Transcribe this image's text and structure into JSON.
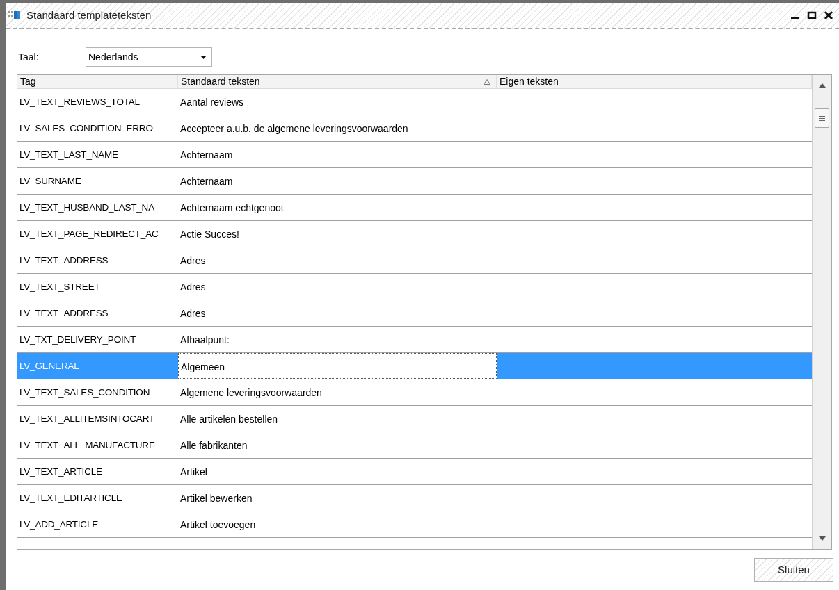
{
  "window": {
    "title": "Standaard templateteksten"
  },
  "language": {
    "label": "Taal:",
    "value": "Nederlands"
  },
  "table": {
    "columns": [
      {
        "label": "Tag",
        "sorted": false
      },
      {
        "label": "Standaard teksten",
        "sorted": true
      },
      {
        "label": "Eigen teksten",
        "sorted": false
      }
    ],
    "rows": [
      {
        "tag": "LV_TEXT_REVIEWS_TOTAL",
        "standard": "Aantal reviews",
        "selected": false
      },
      {
        "tag": "LV_SALES_CONDITION_ERRO",
        "standard": "Accepteer a.u.b. de algemene leveringsvoorwaarden",
        "selected": false
      },
      {
        "tag": "LV_TEXT_LAST_NAME",
        "standard": "Achternaam",
        "selected": false
      },
      {
        "tag": "LV_SURNAME",
        "standard": "Achternaam",
        "selected": false
      },
      {
        "tag": "LV_TEXT_HUSBAND_LAST_NA",
        "standard": "Achternaam echtgenoot",
        "selected": false
      },
      {
        "tag": "LV_TEXT_PAGE_REDIRECT_AC",
        "standard": "Actie Succes!",
        "selected": false
      },
      {
        "tag": "LV_TEXT_ADDRESS",
        "standard": "Adres",
        "selected": false
      },
      {
        "tag": "LV_TEXT_STREET",
        "standard": "Adres",
        "selected": false
      },
      {
        "tag": "LV_TEXT_ADDRESS",
        "standard": "Adres",
        "selected": false
      },
      {
        "tag": "LV_TXT_DELIVERY_POINT",
        "standard": "Afhaalpunt:",
        "selected": false
      },
      {
        "tag": "LV_GENERAL",
        "standard": "Algemeen",
        "selected": true
      },
      {
        "tag": "LV_TEXT_SALES_CONDITION",
        "standard": "Algemene leveringsvoorwaarden",
        "selected": false
      },
      {
        "tag": "LV_TEXT_ALLITEMSINTOCART",
        "standard": "Alle artikelen bestellen",
        "selected": false
      },
      {
        "tag": "LV_TEXT_ALL_MANUFACTURE",
        "standard": "Alle fabrikanten",
        "selected": false
      },
      {
        "tag": "LV_TEXT_ARTICLE",
        "standard": "Artikel",
        "selected": false
      },
      {
        "tag": "LV_TEXT_EDITARTICLE",
        "standard": "Artikel bewerken",
        "selected": false
      },
      {
        "tag": "LV_ADD_ARTICLE",
        "standard": "Artikel toevoegen",
        "selected": false
      }
    ]
  },
  "buttons": [
    "Sluiten"
  ]
}
